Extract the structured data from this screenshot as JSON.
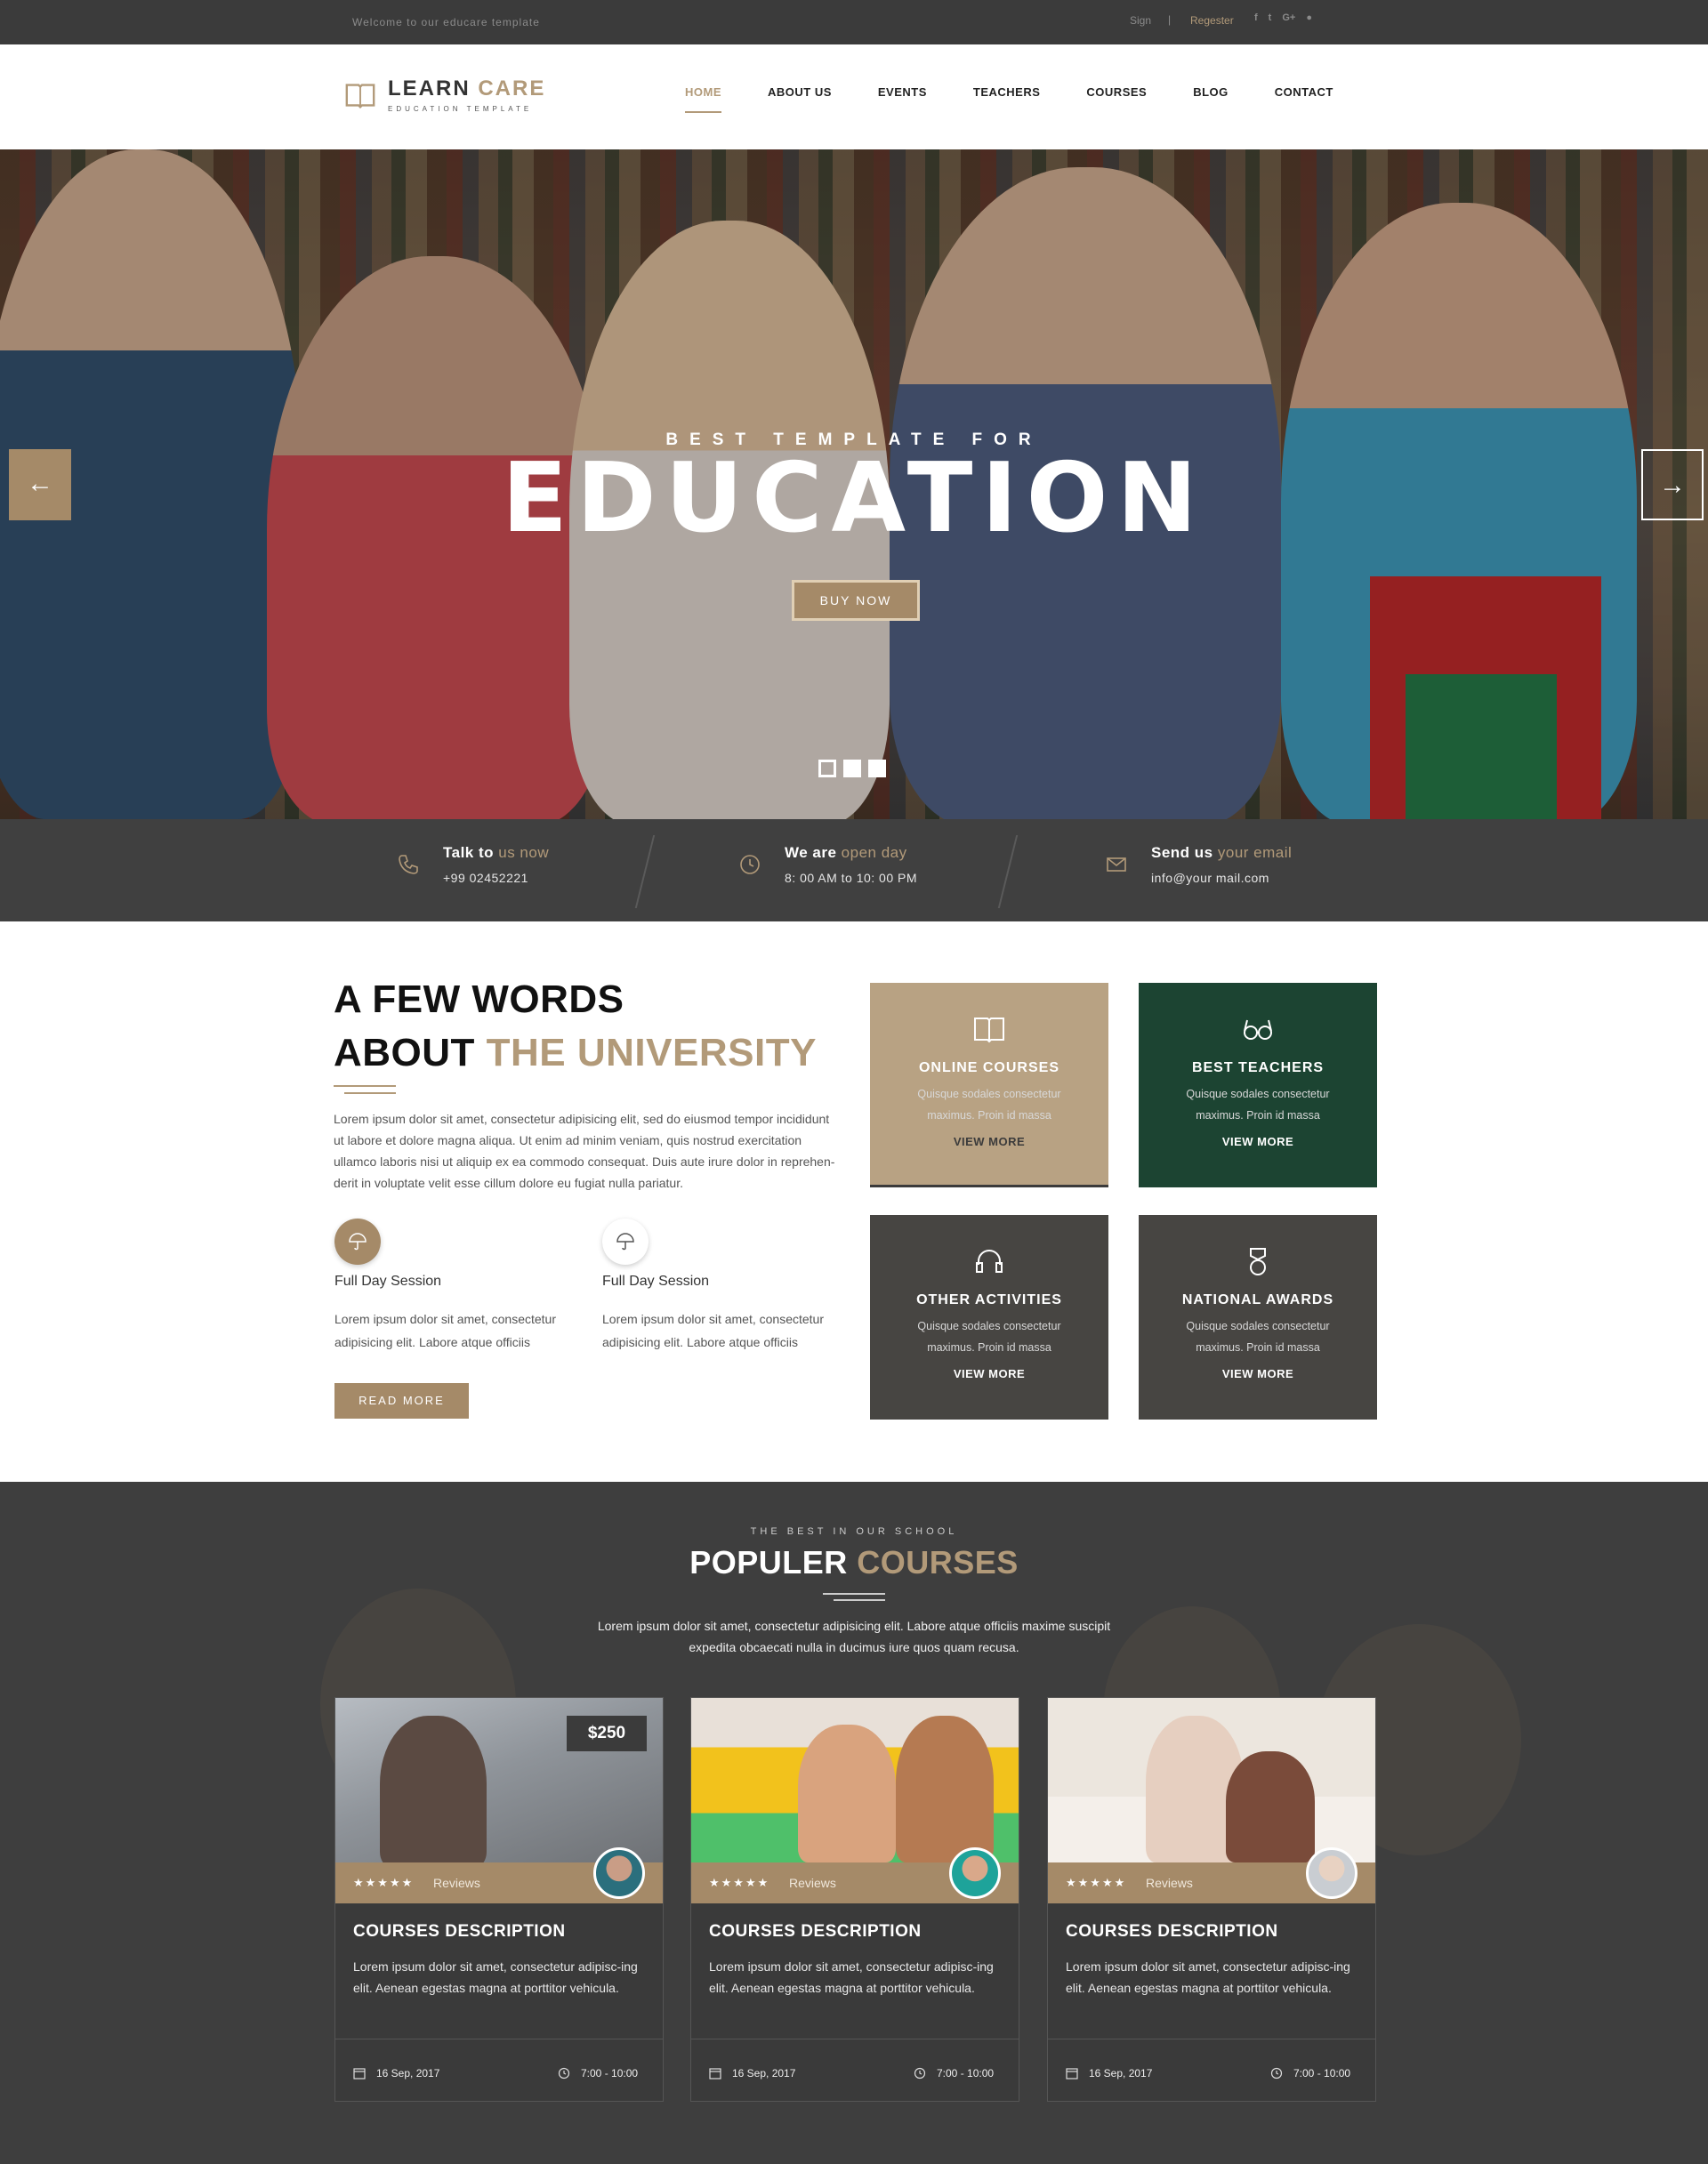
{
  "topbar": {
    "welcome": "Welcome to our educare template",
    "sign": "Sign",
    "separator": "|",
    "register": "Regester",
    "social": [
      "f",
      "t",
      "G+",
      "●"
    ]
  },
  "header": {
    "brand_part1": "LEARN ",
    "brand_part2": "CARE",
    "tagline": "EDUCATION TEMPLATE",
    "nav": [
      {
        "label": "HOME"
      },
      {
        "label": "ABOUT US"
      },
      {
        "label": "EVENTS"
      },
      {
        "label": "TEACHERS"
      },
      {
        "label": "COURSES"
      },
      {
        "label": "BLOG"
      },
      {
        "label": "CONTACT"
      }
    ]
  },
  "hero": {
    "subtitle": "BEST TEMPLATE FOR",
    "title": "EDUCATION",
    "button": "BUY NOW",
    "prev": "←",
    "next": "→",
    "slides_total": 3,
    "slide_active": 1
  },
  "contact": [
    {
      "title_a": "Talk to ",
      "title_b": "us now",
      "value": "+99 02452221",
      "icon": "phone-icon"
    },
    {
      "title_a": "We are ",
      "title_b": "open day",
      "value": "8: 00 AM to 10: 00 PM",
      "icon": "clock-icon"
    },
    {
      "title_a": "Send us ",
      "title_b": "your email",
      "value": "info@your mail.com",
      "icon": "mail-icon"
    }
  ],
  "about": {
    "heading_line1": "A FEW WORDS",
    "heading_line2a": "ABOUT ",
    "heading_line2b": "THE UNIVERSITY",
    "paragraph": "Lorem ipsum dolor sit amet, consectetur adipisicing elit, sed do eiusmod tempor incididunt ut labore et dolore magna aliqua. Ut enim ad minim veniam, quis nostrud exercitation ullamco laboris nisi ut aliquip ex ea commodo consequat. Duis aute irure dolor in reprehen-derit in voluptate velit esse cillum dolore eu fugiat nulla pariatur.",
    "sessions": [
      {
        "title": "Full Day Session",
        "text": "Lorem ipsum dolor sit amet, consectetur adipisicing elit. Labore atque officiis"
      },
      {
        "title": "Full Day Session",
        "text": "Lorem ipsum dolor sit amet, consectetur adipisicing elit. Labore atque officiis"
      }
    ],
    "read_more": "READ MORE"
  },
  "features": [
    {
      "title": "ONLINE COURSES",
      "text": "Quisque sodales consectetur maximus. Proin id massa",
      "link": "VIEW MORE",
      "icon": "book-icon",
      "color": "#b8a283"
    },
    {
      "title": "BEST TEACHERS",
      "text": "Quisque sodales consectetur maximus. Proin id massa",
      "link": "VIEW MORE",
      "icon": "glasses-icon",
      "color": "#1c4432"
    },
    {
      "title": "OTHER ACTIVITIES",
      "text": "Quisque sodales consectetur maximus. Proin id massa",
      "link": "VIEW MORE",
      "icon": "headset-icon",
      "color": "#474542"
    },
    {
      "title": "NATIONAL AWARDS",
      "text": "Quisque sodales consectetur maximus. Proin id massa",
      "link": "VIEW MORE",
      "icon": "medal-icon",
      "color": "#474542"
    }
  ],
  "courses": {
    "kicker": "THE BEST IN OUR SCHOOL",
    "heading_a": "POPULER ",
    "heading_b": "COURSES",
    "intro": "Lorem ipsum dolor sit amet, consectetur adipisicing elit. Labore atque officiis maxime suscipit expedita obcaecati nulla in ducimus iure quos quam recusa.",
    "cards": [
      {
        "price": "$250",
        "stars": "★★★★★",
        "reviews": "Reviews",
        "title": "COURSES DESCRIPTION",
        "text": "Lorem ipsum dolor sit amet, consectetur adipisc-ing elit. Aenean egestas magna at porttitor vehicula.",
        "date": "16 Sep, 2017",
        "time": "7:00 - 10:00"
      },
      {
        "price": "",
        "stars": "★★★★★",
        "reviews": "Reviews",
        "title": "COURSES DESCRIPTION",
        "text": "Lorem ipsum dolor sit amet, consectetur adipisc-ing elit. Aenean egestas magna at porttitor vehicula.",
        "date": "16 Sep, 2017",
        "time": "7:00 - 10:00"
      },
      {
        "price": "",
        "stars": "★★★★★",
        "reviews": "Reviews",
        "title": "COURSES DESCRIPTION",
        "text": "Lorem ipsum dolor sit amet, consectetur adipisc-ing elit. Aenean egestas magna at porttitor vehicula.",
        "date": "16 Sep, 2017",
        "time": "7:00 - 10:00"
      }
    ]
  },
  "colors": {
    "accent": "#b29a79",
    "dark": "#3e3e3e",
    "green": "#1c4432"
  }
}
